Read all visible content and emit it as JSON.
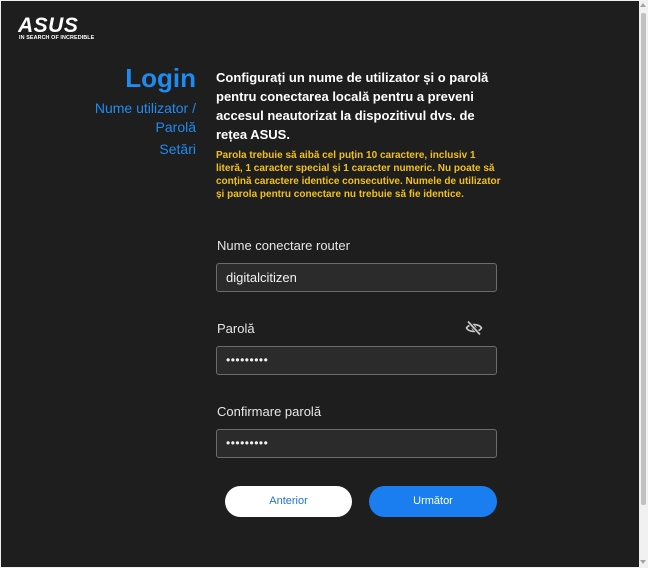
{
  "brand": {
    "name": "ASUS",
    "tagline": "IN SEARCH OF INCREDIBLE"
  },
  "sidebar": {
    "title": "Login",
    "steps": [
      {
        "label": "Nume utilizator / Parolă"
      },
      {
        "label": "Setări"
      }
    ]
  },
  "main": {
    "heading": "Configurați un nume de utilizator și o parolă pentru conectarea locală pentru a preveni accesul neautorizat la dispozitivul dvs. de rețea ASUS.",
    "warning": "Parola trebuie să aibă cel puțin 10 caractere, inclusiv 1 literă, 1 caracter special și 1 caracter numeric. Nu poate să conțină caractere identice consecutive. Numele de utilizator și parola pentru conectare nu trebuie să fie identice.",
    "fields": {
      "router_name": {
        "label": "Nume conectare router",
        "value": "digitalcitizen"
      },
      "password": {
        "label": "Parolă",
        "value": "•••••••••",
        "visibility_icon": "eye-off-icon"
      },
      "confirm_password": {
        "label": "Confirmare parolă",
        "value": "•••••••••"
      }
    },
    "buttons": {
      "previous": "Anterior",
      "next": "Următor"
    }
  },
  "colors": {
    "background": "#1e1e1f",
    "accent": "#1e8bf0",
    "warning": "#f2c016",
    "primary_button": "#1a7ef0"
  }
}
